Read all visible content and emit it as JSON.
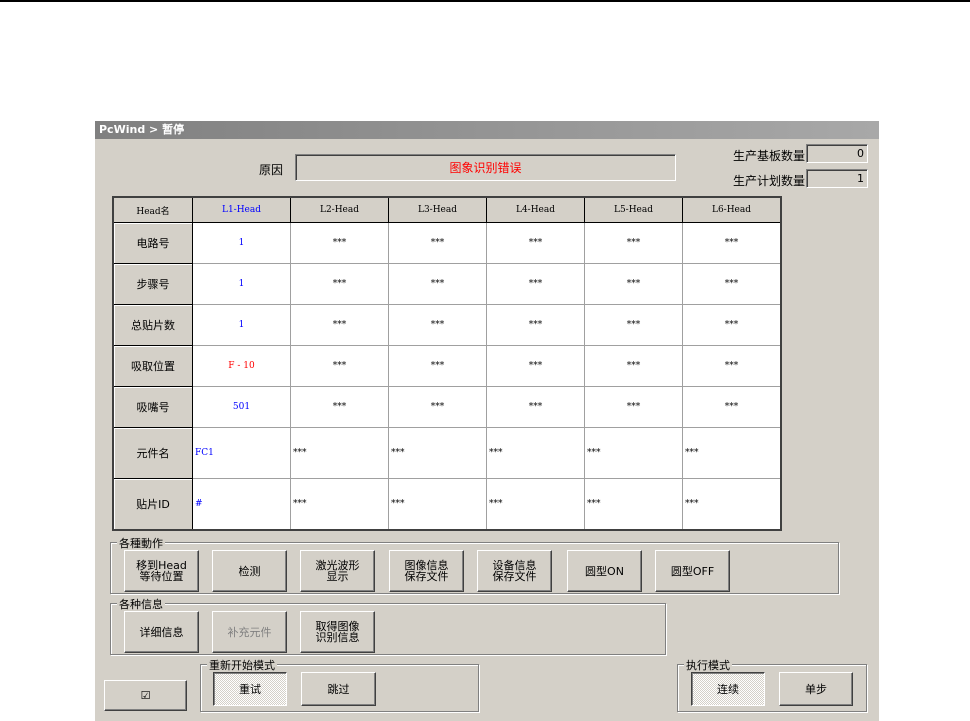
{
  "window": {
    "title": "PcWind > 暂停"
  },
  "reason": {
    "label": "原因",
    "value": "图象识别错误"
  },
  "counts": {
    "board_label": "生产基板数量",
    "board_value": "0",
    "plan_label": "生产计划数量",
    "plan_value": "1"
  },
  "table": {
    "corner": "Head名",
    "headers": [
      "L1-Head",
      "L2-Head",
      "L3-Head",
      "L4-Head",
      "L5-Head",
      "L6-Head"
    ],
    "rows": [
      {
        "label": "电路号",
        "cells": [
          "1",
          "***",
          "***",
          "***",
          "***",
          "***"
        ]
      },
      {
        "label": "步骤号",
        "cells": [
          "1",
          "***",
          "***",
          "***",
          "***",
          "***"
        ]
      },
      {
        "label": "总贴片数",
        "cells": [
          "1",
          "***",
          "***",
          "***",
          "***",
          "***"
        ]
      },
      {
        "label": "吸取位置",
        "cells": [
          "F - 10",
          "***",
          "***",
          "***",
          "***",
          "***"
        ]
      },
      {
        "label": "吸嘴号",
        "cells": [
          "501",
          "***",
          "***",
          "***",
          "***",
          "***"
        ]
      },
      {
        "label": "元件名",
        "cells": [
          "FC1",
          "***",
          "***",
          "***",
          "***",
          "***"
        ]
      },
      {
        "label": "贴片ID",
        "cells": [
          "#",
          "***",
          "***",
          "***",
          "***",
          "***"
        ]
      }
    ]
  },
  "actions": {
    "label": "各種動作",
    "buttons": [
      "移到Head\n等待位置",
      "检测",
      "激光波形\n显示",
      "图像信息\n保存文件",
      "设备信息\n保存文件",
      "圆型ON",
      "圆型OFF"
    ]
  },
  "info": {
    "label": "各种信息",
    "buttons": [
      "详细信息",
      "补充元件",
      "取得图像\n识别信息"
    ]
  },
  "restart": {
    "label": "重新开始模式",
    "retry": "重试",
    "skip": "跳过"
  },
  "exec": {
    "label": "执行模式",
    "continuous": "连续",
    "step": "单步"
  },
  "check_button": "☑"
}
